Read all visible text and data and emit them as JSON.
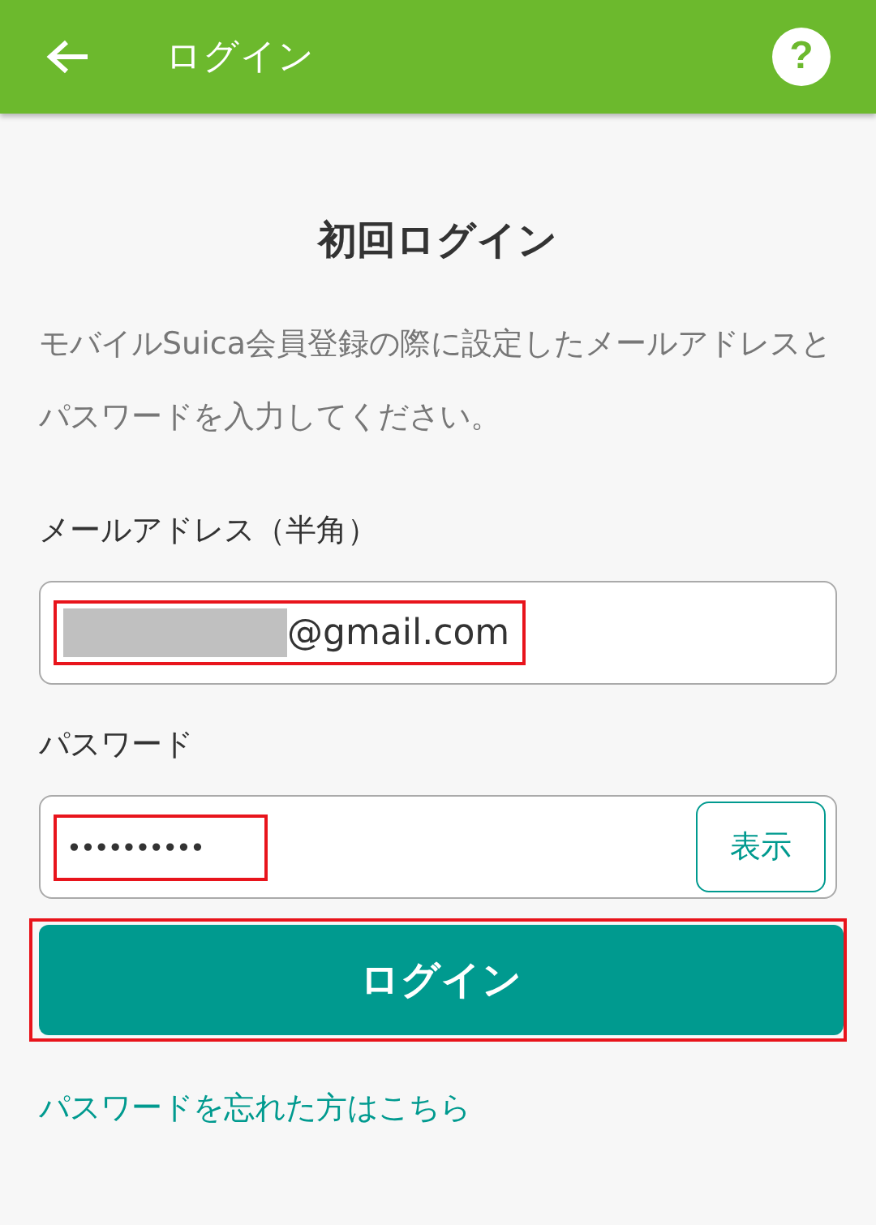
{
  "header": {
    "title": "ログイン",
    "help_icon": "?"
  },
  "heading": "初回ログイン",
  "description": "モバイルSuica会員登録の際に設定したメールアドレスとパスワードを入力してください。",
  "email": {
    "label": "メールアドレス（半角）",
    "value": "@gmail.com",
    "redacted": true,
    "highlighted": true
  },
  "password": {
    "label": "パスワード",
    "value": "••••••••••",
    "show_button": "表示",
    "highlighted": true
  },
  "login_button": {
    "label": "ログイン",
    "highlighted": true
  },
  "forgot_link": "パスワードを忘れた方はこちら"
}
